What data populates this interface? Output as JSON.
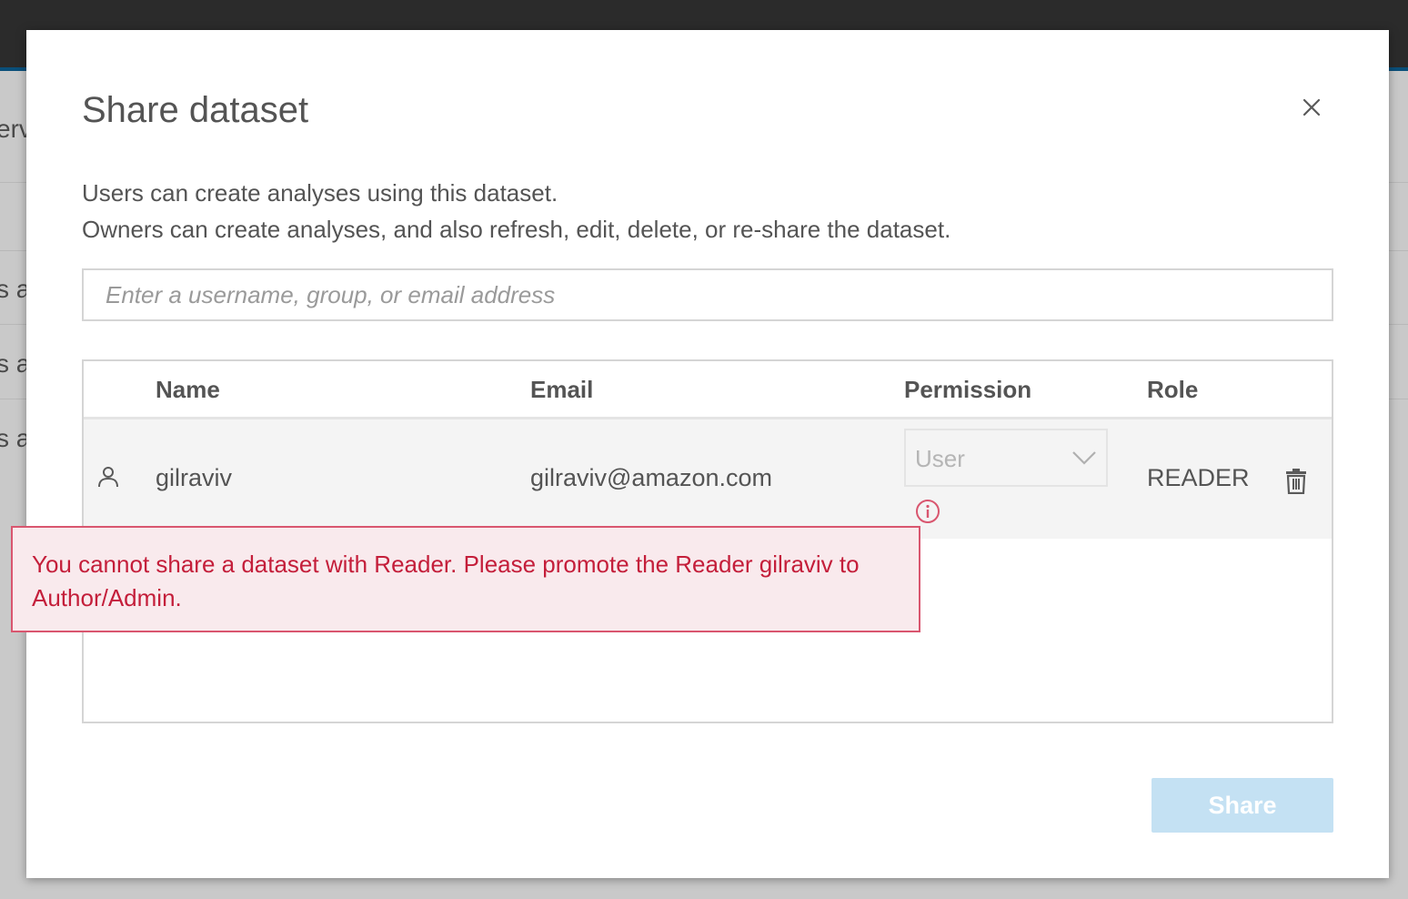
{
  "background": {
    "text_fragments": [
      "erv",
      "s ar",
      "s ar",
      "s ar"
    ]
  },
  "dialog": {
    "title": "Share dataset",
    "close_icon": "close-icon",
    "description": [
      "Users can create analyses using this dataset.",
      "Owners can create analyses, and also refresh, edit, delete, or re-share the dataset."
    ],
    "search": {
      "value": "",
      "placeholder": "Enter a username, group, or email address"
    },
    "table": {
      "columns": [
        "Name",
        "Email",
        "Permission",
        "Role"
      ],
      "rows": [
        {
          "icon": "user-icon",
          "name": "gilraviv",
          "email": "gilraviv@amazon.com",
          "permission": "User",
          "permission_disabled": true,
          "role": "READER",
          "info_icon": "info-icon",
          "delete_icon": "trash-icon"
        }
      ]
    },
    "error_message": "You cannot share a dataset with Reader. Please promote the Reader gilraviv to Author/Admin.",
    "share_button": "Share",
    "share_button_disabled": true
  },
  "colors": {
    "error_text": "#c41e3a",
    "error_border": "#d9566f",
    "error_background": "#f9eaed",
    "share_button_disabled": "#c4e1f3",
    "top_bar": "#2b2b2b",
    "accent": "#0a4f7a"
  }
}
